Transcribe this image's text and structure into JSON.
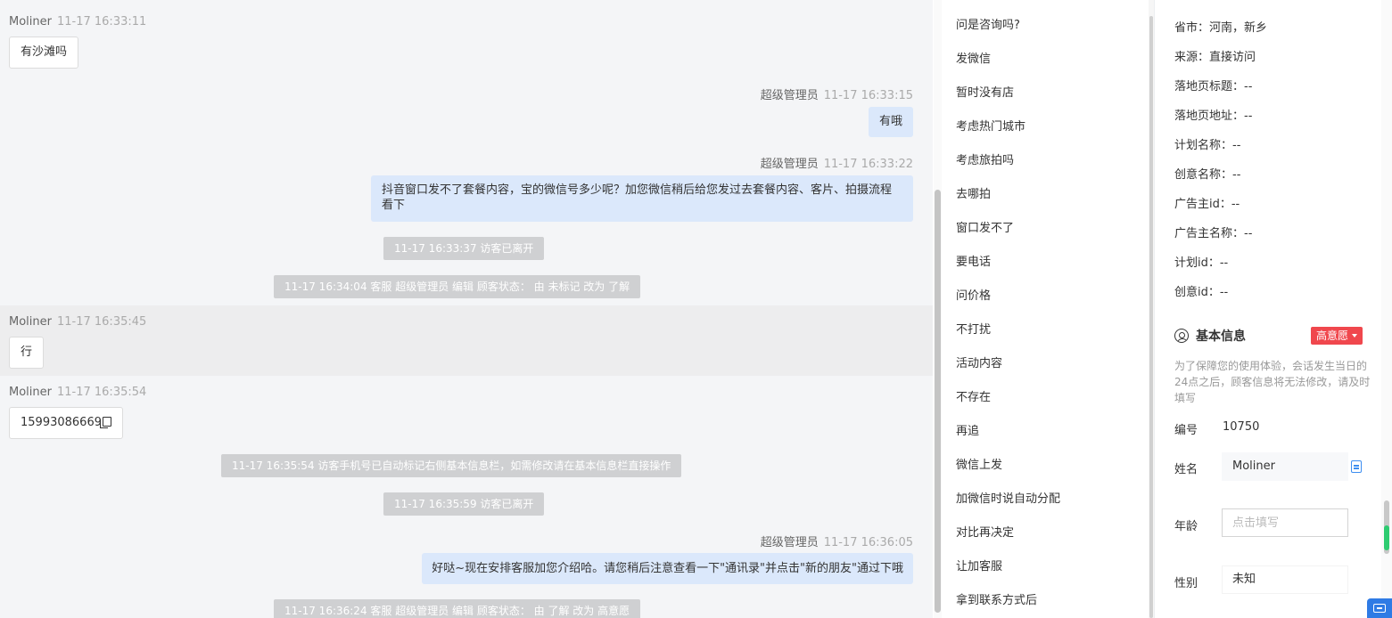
{
  "chat": {
    "messages": [
      {
        "sender": "Moliner",
        "time": "11-17 16:33:11",
        "text": "有沙滩吗"
      },
      {
        "sender": "超级管理员",
        "time": "11-17 16:33:15",
        "text": "有哦"
      },
      {
        "sender": "超级管理员",
        "time": "11-17 16:33:22",
        "text": "抖音窗口发不了套餐内容，宝的微信号多少呢？加您微信稍后给您发过去套餐内容、客片、拍摄流程看下"
      },
      {
        "system": "11-17 16:33:37 访客已离开"
      },
      {
        "system": "11-17 16:34:04 客服 超级管理员 编辑 顾客状态： 由 未标记 改为 了解"
      },
      {
        "sender": "Moliner",
        "time": "11-17 16:35:45",
        "text": "行"
      },
      {
        "sender": "Moliner",
        "time": "11-17 16:35:54",
        "text": "15993086669"
      },
      {
        "system": "11-17 16:35:54 访客手机号已自动标记右侧基本信息栏，如需修改请在基本信息栏直接操作"
      },
      {
        "system": "11-17 16:35:59 访客已离开"
      },
      {
        "sender": "超级管理员",
        "time": "11-17 16:36:05",
        "text": "好哒~现在安排客服加您介绍哈。请您稍后注意查看一下\"通讯录\"并点击\"新的朋友\"通过下哦"
      },
      {
        "system": "11-17 16:36:24 客服 超级管理员 编辑 顾客状态： 由 了解 改为 高意愿"
      }
    ]
  },
  "quick_replies": [
    "问是咨询吗?",
    "发微信",
    "暂时没有店",
    "考虑热门城市",
    "考虑旅拍吗",
    "去哪拍",
    "窗口发不了",
    "要电话",
    "问价格",
    "不打扰",
    "活动内容",
    "不存在",
    "再追",
    "微信上发",
    "加微信时说自动分配",
    "对比再决定",
    "让加客服",
    "拿到联系方式后"
  ],
  "info": {
    "fields": [
      "省市：河南，新乡",
      "来源：直接访问",
      "落地页标题：--",
      "落地页地址：--",
      "计划名称：--",
      "创意名称：--",
      "广告主id：--",
      "广告主名称：--",
      "计划id：--",
      "创意id：--"
    ],
    "basic": {
      "title": "基本信息",
      "intent_tag": "高意愿",
      "notice": "为了保障您的使用体验，会话发生当日的24点之后，顾客信息将无法修改，请及时填写",
      "id_label": "编号",
      "id_value": "10750",
      "name_label": "姓名",
      "name_value": "Moliner",
      "age_label": "年龄",
      "age_placeholder": "点击填写",
      "gender_label": "性别",
      "gender_value": "未知"
    }
  },
  "colors": {
    "outgoing_bubble": "#dbe8fb",
    "system_notice": "#cfd0d2",
    "intent_tag": "#f0474d",
    "accent_blue": "#2f7be5"
  }
}
